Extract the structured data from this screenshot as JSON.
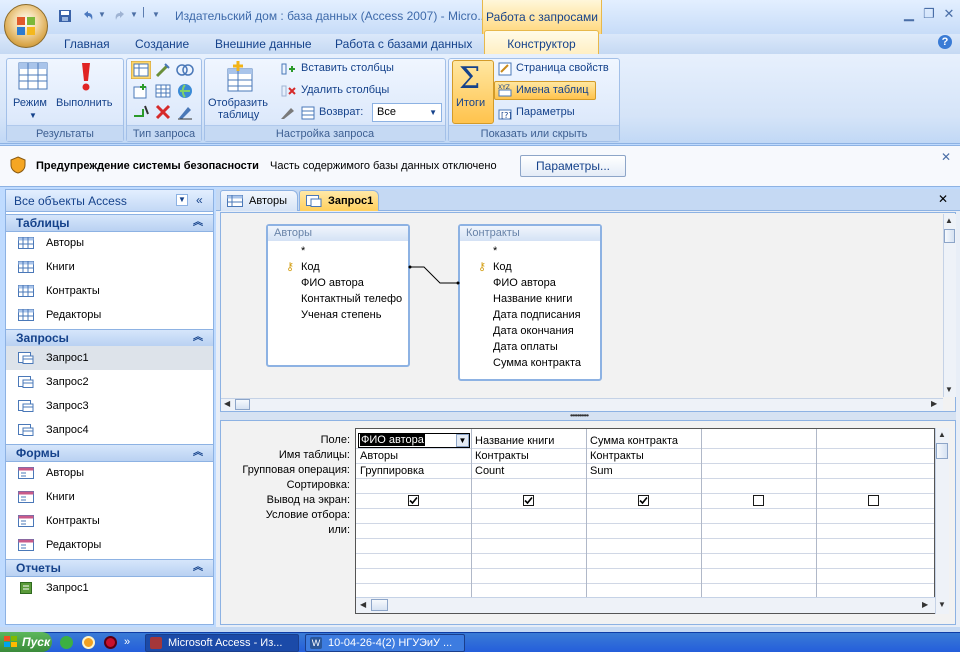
{
  "window": {
    "title": "Издательский дом : база данных (Access 2007) - Micro...",
    "context_title": "Работа с запросами"
  },
  "ribbon": {
    "tabs": [
      "Главная",
      "Создание",
      "Внешние данные",
      "Работа с базами данных"
    ],
    "active_tab": "Конструктор",
    "groups": {
      "results": "Результаты",
      "query_type": "Тип запроса",
      "setup": "Настройка запроса",
      "show_hide": "Показать или скрыть"
    },
    "buttons": {
      "mode": "Режим",
      "run": "Выполнить",
      "show_table_1": "Отобразить",
      "show_table_2": "таблицу",
      "insert_cols": "Вставить столбцы",
      "delete_cols": "Удалить столбцы",
      "return": "Возврат:",
      "return_value": "Все",
      "totals": "Итоги",
      "property_sheet": "Страница свойств",
      "table_names": "Имена таблиц",
      "parameters": "Параметры"
    }
  },
  "security": {
    "title": "Предупреждение системы безопасности",
    "message": "Часть содержимого базы данных отключено",
    "button": "Параметры..."
  },
  "nav": {
    "header": "Все объекты Access",
    "sections": [
      {
        "title": "Таблицы",
        "items": [
          "Авторы",
          "Книги",
          "Контракты",
          "Редакторы"
        ]
      },
      {
        "title": "Запросы",
        "items": [
          "Запрос1",
          "Запрос2",
          "Запрос3",
          "Запрос4"
        ]
      },
      {
        "title": "Формы",
        "items": [
          "Авторы",
          "Книги",
          "Контракты",
          "Редакторы"
        ]
      },
      {
        "title": "Отчеты",
        "items": [
          "Запрос1"
        ]
      }
    ]
  },
  "doc_tabs": [
    "Авторы",
    "Запрос1"
  ],
  "tables": [
    {
      "title": "Авторы",
      "fields": [
        "*",
        "Код",
        "ФИО автора",
        "Контактный телефо",
        "Ученая степень"
      ]
    },
    {
      "title": "Контракты",
      "fields": [
        "*",
        "Код",
        "ФИО автора",
        "Название книги",
        "Дата подписания",
        "Дата окончания",
        "Дата оплаты",
        "Сумма контракта"
      ]
    }
  ],
  "grid": {
    "row_labels": [
      "Поле:",
      "Имя таблицы:",
      "Групповая операция:",
      "Сортировка:",
      "Вывод на экран:",
      "Условие отбора:",
      "или:"
    ],
    "columns": [
      {
        "field": "ФИО автора",
        "table": "Авторы",
        "total": "Группировка",
        "show": true
      },
      {
        "field": "Название книги",
        "table": "Контракты",
        "total": "Count",
        "show": true
      },
      {
        "field": "Сумма контракта",
        "table": "Контракты",
        "total": "Sum",
        "show": true
      },
      {
        "field": "",
        "table": "",
        "total": "",
        "show": false
      },
      {
        "field": "",
        "table": "",
        "total": "",
        "show": false
      }
    ]
  },
  "taskbar": {
    "start": "Пуск",
    "tasks": [
      "Microsoft Access - Из...",
      "10-04-26-4(2) НГУЭиУ ..."
    ]
  }
}
